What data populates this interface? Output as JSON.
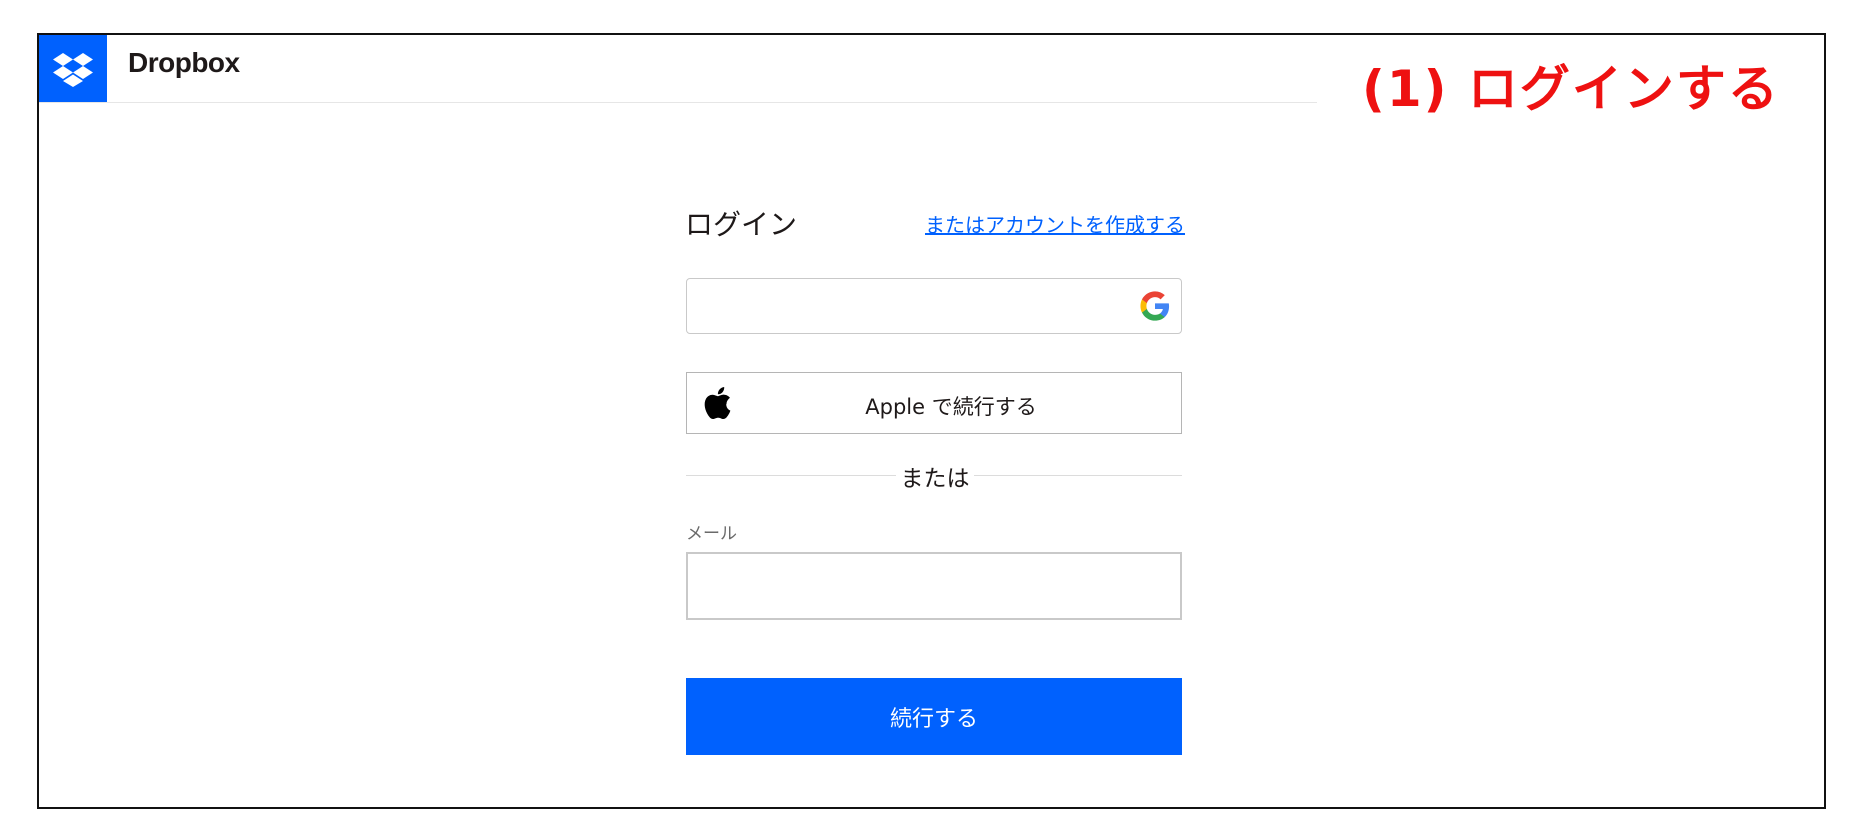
{
  "header": {
    "brand": "Dropbox",
    "logo_icon": "dropbox-logo-icon"
  },
  "annotation": {
    "text": "(1) ログインする",
    "color": "#ee1111"
  },
  "login": {
    "title": "ログイン",
    "create_account_link": "またはアカウントを作成する",
    "google_icon": "google-g-icon",
    "apple_button_label": "Apple で続行する",
    "apple_icon": "apple-icon",
    "divider_text": "または",
    "email_label": "メール",
    "email_value": "",
    "continue_button_label": "続行する"
  },
  "colors": {
    "brand_blue": "#0061fe",
    "link_blue": "#0061fe",
    "annotation_red": "#ee1111"
  }
}
